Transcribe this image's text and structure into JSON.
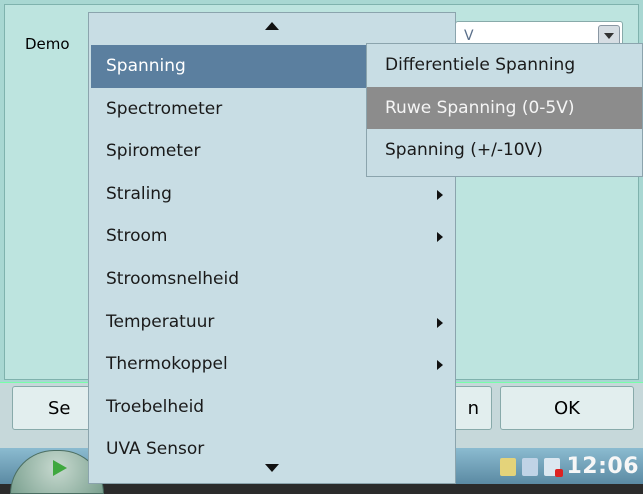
{
  "dialog": {
    "label": "Demo",
    "combo_value": "V",
    "buttons": {
      "select": "Se",
      "cancel": "n",
      "ok": "OK"
    }
  },
  "menu": {
    "items": [
      {
        "label": "Spanning",
        "submenu": false,
        "active": true
      },
      {
        "label": "Spectrometer",
        "submenu": false
      },
      {
        "label": "Spirometer",
        "submenu": false
      },
      {
        "label": "Straling",
        "submenu": true
      },
      {
        "label": "Stroom",
        "submenu": true
      },
      {
        "label": "Stroomsnelheid",
        "submenu": false
      },
      {
        "label": "Temperatuur",
        "submenu": true
      },
      {
        "label": "Thermokoppel",
        "submenu": true
      },
      {
        "label": "Troebelheid",
        "submenu": false
      },
      {
        "label": "UVA Sensor",
        "submenu": false
      }
    ]
  },
  "submenu": {
    "items": [
      {
        "label": "Differentiele Spanning"
      },
      {
        "label": "Ruwe Spanning (0-5V)",
        "highlighted": true
      },
      {
        "label": "Spanning (+/-10V)"
      }
    ]
  },
  "taskbar": {
    "clock": "12:06",
    "icons": [
      "network-icon",
      "keyboard-icon",
      "volume-muted-icon"
    ]
  },
  "colors": {
    "menu_bg": "#c8dde4",
    "menu_active": "#5b7f9f",
    "submenu_highlight": "#8c8c8c",
    "dialog_bg": "#bde4df"
  }
}
